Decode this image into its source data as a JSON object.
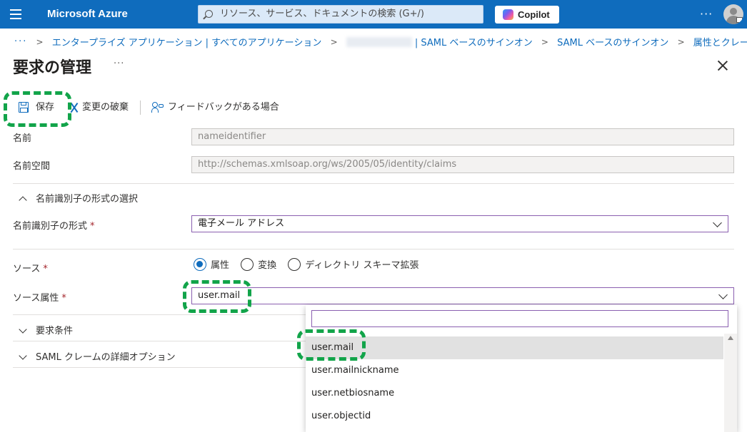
{
  "header": {
    "brand": "Microsoft Azure",
    "search_placeholder": "リソース、サービス、ドキュメントの検索 (G+/)",
    "copilot_label": "Copilot",
    "more": "···"
  },
  "breadcrumb": {
    "more": "···",
    "items": [
      "エンタープライズ アプリケーション | すべてのアプリケーション",
      "| SAML ベースのサインオン",
      "SAML ベースのサインオン",
      "属性とクレーム"
    ]
  },
  "page": {
    "title": "要求の管理",
    "more": "···"
  },
  "toolbar": {
    "save": "保存",
    "discard": "変更の破棄",
    "feedback": "フィードバックがある場合"
  },
  "form": {
    "name_label": "名前",
    "name_value": "nameidentifier",
    "namespace_label": "名前空間",
    "namespace_value": "http://schemas.xmlsoap.org/ws/2005/05/identity/claims",
    "format_section": "名前識別子の形式の選択",
    "format_label": "名前識別子の形式",
    "format_value": "電子メール アドレス",
    "source_label": "ソース",
    "source_options": [
      "属性",
      "変換",
      "ディレクトリ スキーマ拡張"
    ],
    "source_attr_label": "ソース属性",
    "source_attr_value": "user.mail",
    "required_mark": "*",
    "conditions_section": "要求条件",
    "advanced_section": "SAML クレームの詳細オプション"
  },
  "dropdown_list": {
    "filter_value": "",
    "options": [
      "user.mail",
      "user.mailnickname",
      "user.netbiosname",
      "user.objectid"
    ],
    "selected_index": 0
  },
  "colors": {
    "brand_bar": "#0f6cbd",
    "highlight": "#12a44a",
    "focus_border": "#8a5fb0",
    "required": "#a4262c"
  }
}
